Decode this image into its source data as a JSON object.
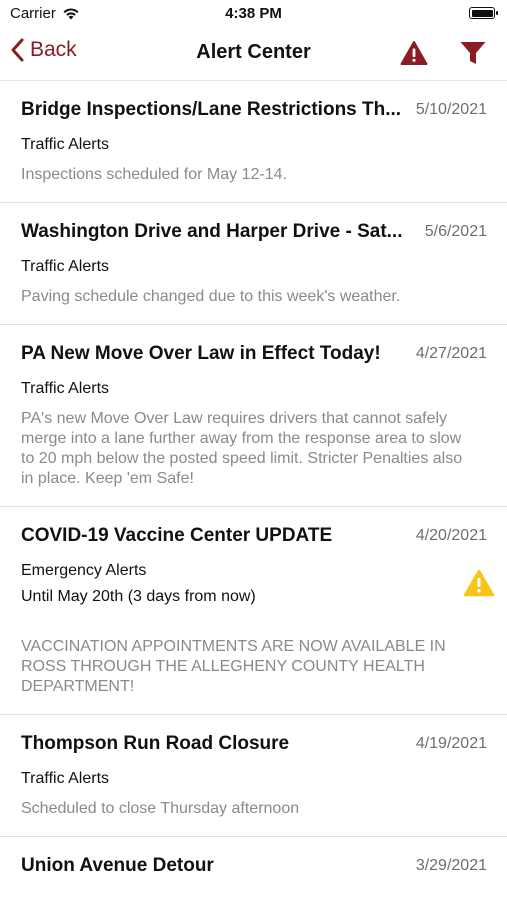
{
  "status_bar": {
    "carrier": "Carrier",
    "time": "4:38 PM"
  },
  "nav": {
    "back_label": "Back",
    "title": "Alert Center"
  },
  "alerts": [
    {
      "title": "Bridge Inspections/Lane Restrictions Th...",
      "date": "5/10/2021",
      "category": "Traffic Alerts",
      "description": "Inspections scheduled for May 12-14."
    },
    {
      "title": "Washington Drive and Harper Drive - Sat...",
      "date": "5/6/2021",
      "category": "Traffic Alerts",
      "description": "Paving schedule changed due to this week's weather."
    },
    {
      "title": "PA New Move Over Law in Effect Today!",
      "date": "4/27/2021",
      "category": "Traffic Alerts",
      "description": "PA's new Move Over Law requires drivers that cannot safely merge into a lane further away from the response area to slow to 20 mph below the posted speed limit.  Stricter Penalties also in place.  Keep 'em Safe!"
    },
    {
      "title": "COVID-19 Vaccine Center UPDATE",
      "date": "4/20/2021",
      "category": "Emergency Alerts",
      "until": "Until May 20th (3 days from now)",
      "description": "VACCINATION APPOINTMENTS ARE NOW AVAILABLE IN ROSS THROUGH THE ALLEGHENY COUNTY HEALTH DEPARTMENT!",
      "icon": "warning-icon"
    },
    {
      "title": "Thompson Run Road Closure",
      "date": "4/19/2021",
      "category": "Traffic Alerts",
      "description": "Scheduled to close Thursday afternoon"
    },
    {
      "title": "Union Avenue Detour",
      "date": "3/29/2021"
    }
  ],
  "colors": {
    "accent": "#8a1c24",
    "warning": "#f5c518",
    "muted_text": "#8a8a8a"
  }
}
